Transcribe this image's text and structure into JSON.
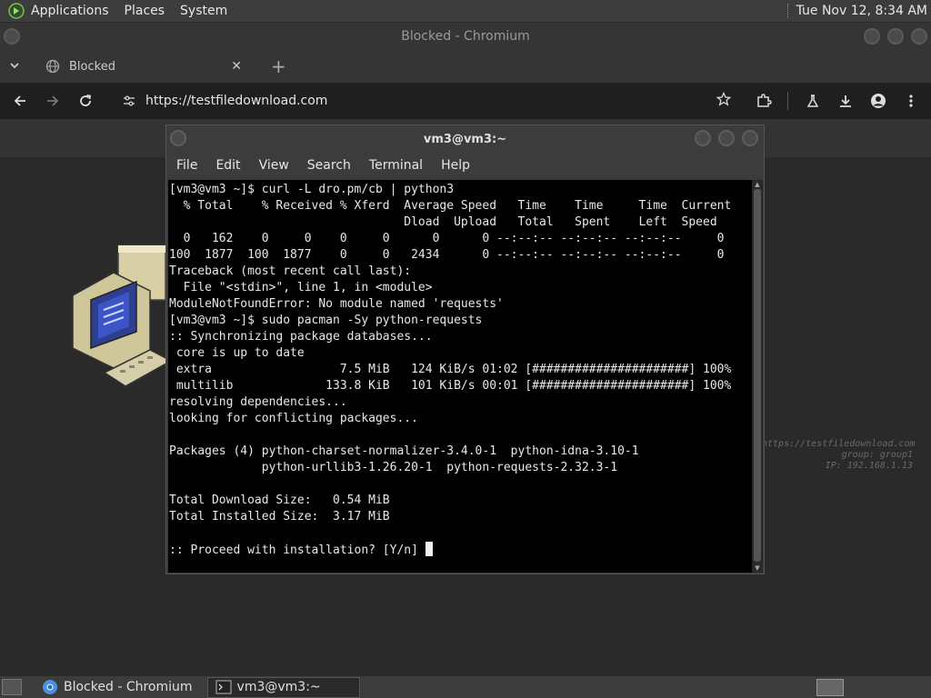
{
  "top_panel": {
    "menus": [
      "Applications",
      "Places",
      "System"
    ],
    "clock": "Tue Nov 12,  8:34 AM"
  },
  "chromium": {
    "window_title": "Blocked - Chromium",
    "tab_title": "Blocked",
    "url": "https://testfiledownload.com",
    "watermark": [
      "https://testfiledownload.com",
      "group: group1",
      "IP: 192.168.1.13"
    ]
  },
  "terminal": {
    "title": "vm3@vm3:~",
    "menus": [
      "File",
      "Edit",
      "View",
      "Search",
      "Terminal",
      "Help"
    ],
    "lines": [
      "[vm3@vm3 ~]$ curl -L dro.pm/cb | python3",
      "  % Total    % Received % Xferd  Average Speed   Time    Time     Time  Current",
      "                                 Dload  Upload   Total   Spent    Left  Speed",
      "  0   162    0     0    0     0      0      0 --:--:-- --:--:-- --:--:--     0",
      "100  1877  100  1877    0     0   2434      0 --:--:-- --:--:-- --:--:--     0",
      "Traceback (most recent call last):",
      "  File \"<stdin>\", line 1, in <module>",
      "ModuleNotFoundError: No module named 'requests'",
      "[vm3@vm3 ~]$ sudo pacman -Sy python-requests",
      ":: Synchronizing package databases...",
      " core is up to date",
      " extra                  7.5 MiB   124 KiB/s 01:02 [######################] 100%",
      " multilib             133.8 KiB   101 KiB/s 00:01 [######################] 100%",
      "resolving dependencies...",
      "looking for conflicting packages...",
      "",
      "Packages (4) python-charset-normalizer-3.4.0-1  python-idna-3.10-1",
      "             python-urllib3-1.26.20-1  python-requests-2.32.3-1",
      "",
      "Total Download Size:   0.54 MiB",
      "Total Installed Size:  3.17 MiB",
      ""
    ],
    "prompt_line": ":: Proceed with installation? [Y/n] "
  },
  "taskbar": {
    "tasks": [
      {
        "label": "Blocked - Chromium",
        "icon": "chromium-icon"
      },
      {
        "label": "vm3@vm3:~",
        "icon": "terminal-icon"
      }
    ]
  },
  "colors": {
    "panel_bg": "#3c3c3c",
    "terminal_bg": "#000000",
    "terminal_fg": "#e8e8e8",
    "chrome_bg": "#2b2b2b"
  }
}
